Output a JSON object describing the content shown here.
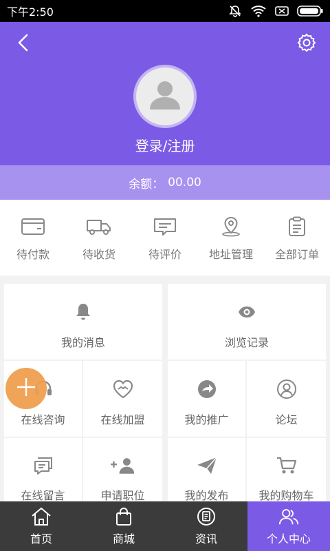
{
  "status_bar": {
    "time": "下午2:50"
  },
  "header": {
    "login_label": "登录/注册"
  },
  "balance": {
    "label": "余额：",
    "amount": "00.00"
  },
  "orders": [
    {
      "label": "待付款",
      "icon": "wallet-icon"
    },
    {
      "label": "待收货",
      "icon": "truck-icon"
    },
    {
      "label": "待评价",
      "icon": "comment-icon"
    },
    {
      "label": "地址管理",
      "icon": "location-pin-icon"
    },
    {
      "label": "全部订单",
      "icon": "clipboard-icon"
    }
  ],
  "grid": {
    "messages": "我的消息",
    "history": "浏览记录",
    "consult": "在线咨询",
    "join": "在线加盟",
    "promotion": "我的推广",
    "forum": "论坛",
    "leave_message": "在线留言",
    "apply_job": "申请职位",
    "my_posts": "我的发布",
    "cart": "我的购物车"
  },
  "bottom_nav": [
    {
      "label": "首页",
      "icon": "home-icon"
    },
    {
      "label": "商城",
      "icon": "shopping-bag-icon"
    },
    {
      "label": "资讯",
      "icon": "news-icon"
    },
    {
      "label": "个人中心",
      "icon": "users-icon",
      "active": true
    }
  ],
  "colors": {
    "primary": "#7b5ae6",
    "balance_bar": "#a792f0",
    "fab": "#f0a050",
    "nav_bg": "#3b3b3b"
  }
}
